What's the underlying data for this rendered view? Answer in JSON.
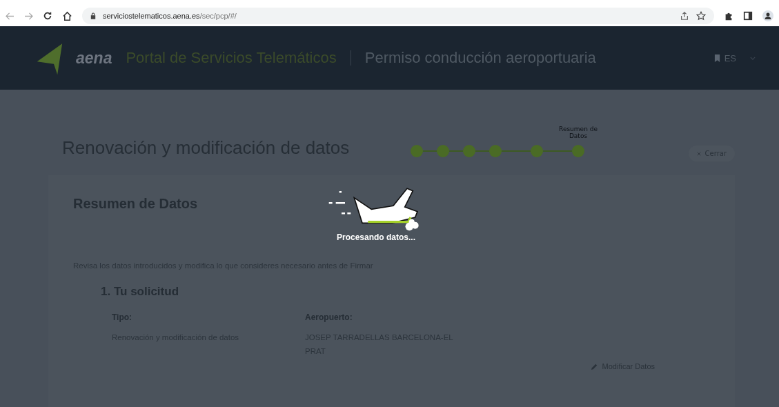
{
  "browser": {
    "url_host": "serviciostelematicos.aena.es",
    "url_path": "/sec/pcp/#/"
  },
  "header": {
    "logo_text": "aena",
    "portal": "Portal de Servicios Telemáticos",
    "section": "Permiso conducción aeroportuaria",
    "language": "ES"
  },
  "page": {
    "title": "Renovación y modificación de datos",
    "close_button": "Cerrar"
  },
  "steps": [
    {
      "done": true
    },
    {
      "done": true
    },
    {
      "done": true
    },
    {
      "done": true
    },
    {
      "done": true
    },
    {
      "done": true,
      "label": "Resumen de Datos"
    }
  ],
  "card": {
    "title": "Resumen de Datos",
    "intro": "Revisa los datos introducidos y modifica lo que consideres necesario antes de Firmar",
    "section_title": "1. Tu solicitud",
    "fields": [
      {
        "label": "Tipo:",
        "value": "Renovación y modificación de datos"
      },
      {
        "label": "Aeropuerto:",
        "value": "JOSEP TARRADELLAS BARCELONA-EL PRAT"
      }
    ],
    "edit_link": "Modificar Datos"
  },
  "loading": {
    "message": "Procesando datos..."
  }
}
